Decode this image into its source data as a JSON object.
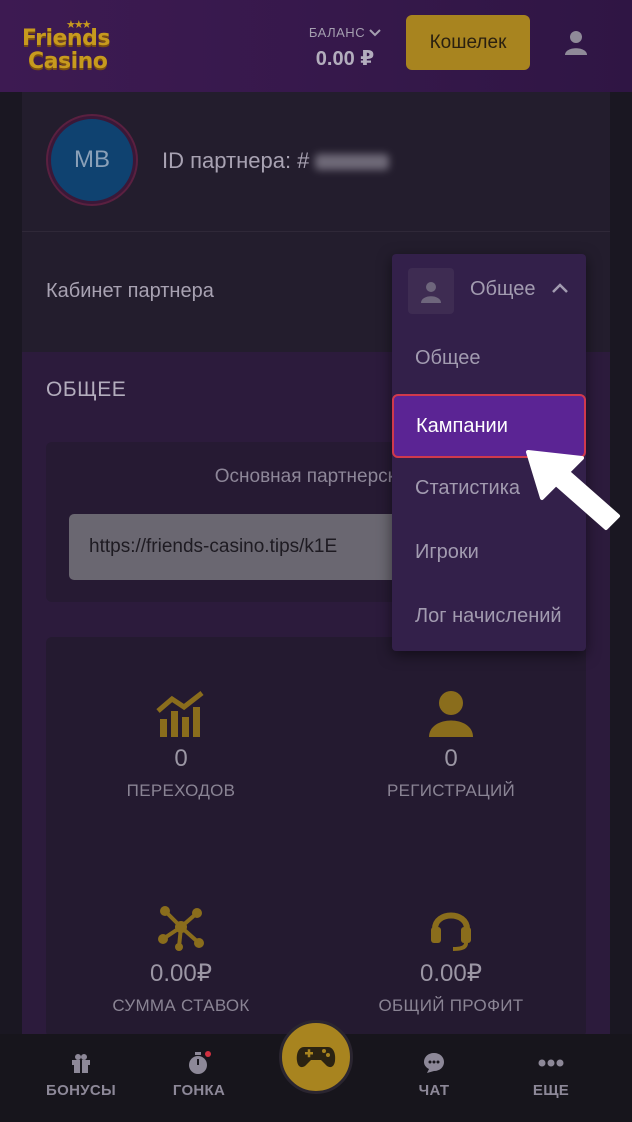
{
  "header": {
    "logo_line1": "Friends",
    "logo_line2": "Casino",
    "balance_label": "БАЛАНС",
    "balance_value": "0.00 ₽",
    "wallet_button": "Кошелек",
    "user_icon": "user-icon"
  },
  "profile": {
    "avatar_initials": "MB",
    "partner_id_label": "ID партнера: #"
  },
  "cabinet": {
    "label": "Кабинет партнера"
  },
  "dropdown": {
    "selected": "Общее",
    "items": [
      "Общее",
      "Кампании",
      "Статистика",
      "Игроки",
      "Лог начислений"
    ],
    "active_index": 1
  },
  "section": {
    "title": "ОБЩЕЕ",
    "link_title": "Основная партнерская",
    "link_value": "https://friends-casino.tips/k1E"
  },
  "stats": [
    {
      "icon": "chart-icon",
      "value": "0",
      "caption": "ПЕРЕХОДОВ"
    },
    {
      "icon": "person-icon",
      "value": "0",
      "caption": "РЕГИСТРАЦИЙ"
    },
    {
      "icon": "network-icon",
      "value": "0.00₽",
      "caption": "СУММА СТАВОК"
    },
    {
      "icon": "headset-icon",
      "value": "0.00₽",
      "caption": "ОБЩИЙ ПРОФИТ"
    }
  ],
  "bottom_nav": {
    "bonuses": "БОНУСЫ",
    "race": "ГОНКА",
    "chat": "ЧАТ",
    "more": "ЕЩЕ"
  },
  "colors": {
    "accent_gold": "#a8841f",
    "active_item": "#5b2494",
    "active_border": "#d0394d"
  }
}
